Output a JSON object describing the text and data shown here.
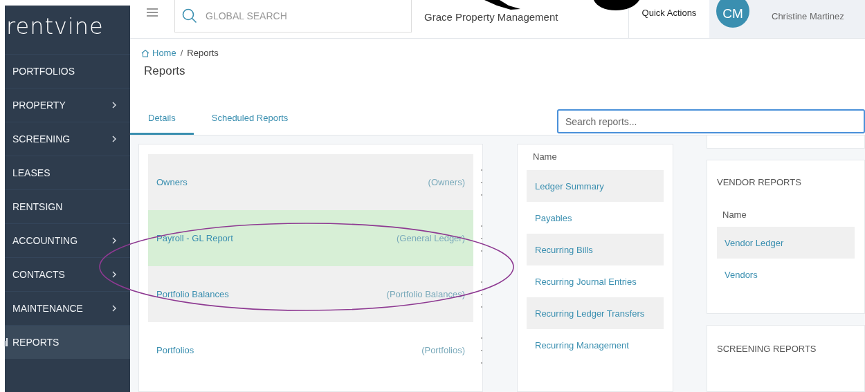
{
  "sidebar": {
    "logo": "rentvine",
    "items": [
      {
        "label": "PORTFOLIOS",
        "has_submenu": false,
        "selected": false
      },
      {
        "label": "PROPERTY",
        "has_submenu": true,
        "selected": false
      },
      {
        "label": "SCREENING",
        "has_submenu": true,
        "selected": false
      },
      {
        "label": "LEASES",
        "has_submenu": false,
        "selected": false
      },
      {
        "label": "RENTSIGN",
        "has_submenu": false,
        "selected": false
      },
      {
        "label": "ACCOUNTING",
        "has_submenu": true,
        "selected": false
      },
      {
        "label": "CONTACTS",
        "has_submenu": true,
        "selected": false
      },
      {
        "label": "MAINTENANCE",
        "has_submenu": true,
        "selected": false
      },
      {
        "label": "REPORTS",
        "has_submenu": false,
        "selected": true
      }
    ]
  },
  "header": {
    "search": {
      "placeholder": "GLOBAL SEARCH"
    },
    "company": "Grace Property Management",
    "quick_actions": "Quick Actions",
    "user": {
      "initials": "CM",
      "name": "Christine Martinez"
    }
  },
  "breadcrumb": [
    {
      "label": "Home"
    },
    {
      "label": "Reports"
    }
  ],
  "breadcrumb_separator": "/",
  "title": "Reports",
  "tabs": [
    {
      "label": "Details",
      "selected": true
    },
    {
      "label": "Scheduled Reports",
      "selected": false
    }
  ],
  "report_search": {
    "placeholder": "Search reports..."
  },
  "saved_reports": [
    {
      "name": "Owners",
      "type": "(Owners)",
      "selected": false
    },
    {
      "name": "Payroll - GL Report",
      "type": "(General Ledger)",
      "selected": true
    },
    {
      "name": "Portfolio Balances",
      "type": "(Portfolio Balances)",
      "selected": false
    },
    {
      "name": "Portfolios",
      "type": "(Portfolios)",
      "selected": false
    }
  ],
  "accounting_reports": {
    "column": "Name",
    "rows": [
      "Ledger Summary",
      "Payables",
      "Recurring Bills",
      "Recurring Journal Entries",
      "Recurring Ledger Transfers",
      "Recurring Management"
    ]
  },
  "vendor_reports": {
    "title": "VENDOR REPORTS",
    "column": "Name",
    "rows": [
      "Vendor Ledger",
      "Vendors"
    ]
  },
  "screening_reports": {
    "title": "SCREENING REPORTS"
  }
}
